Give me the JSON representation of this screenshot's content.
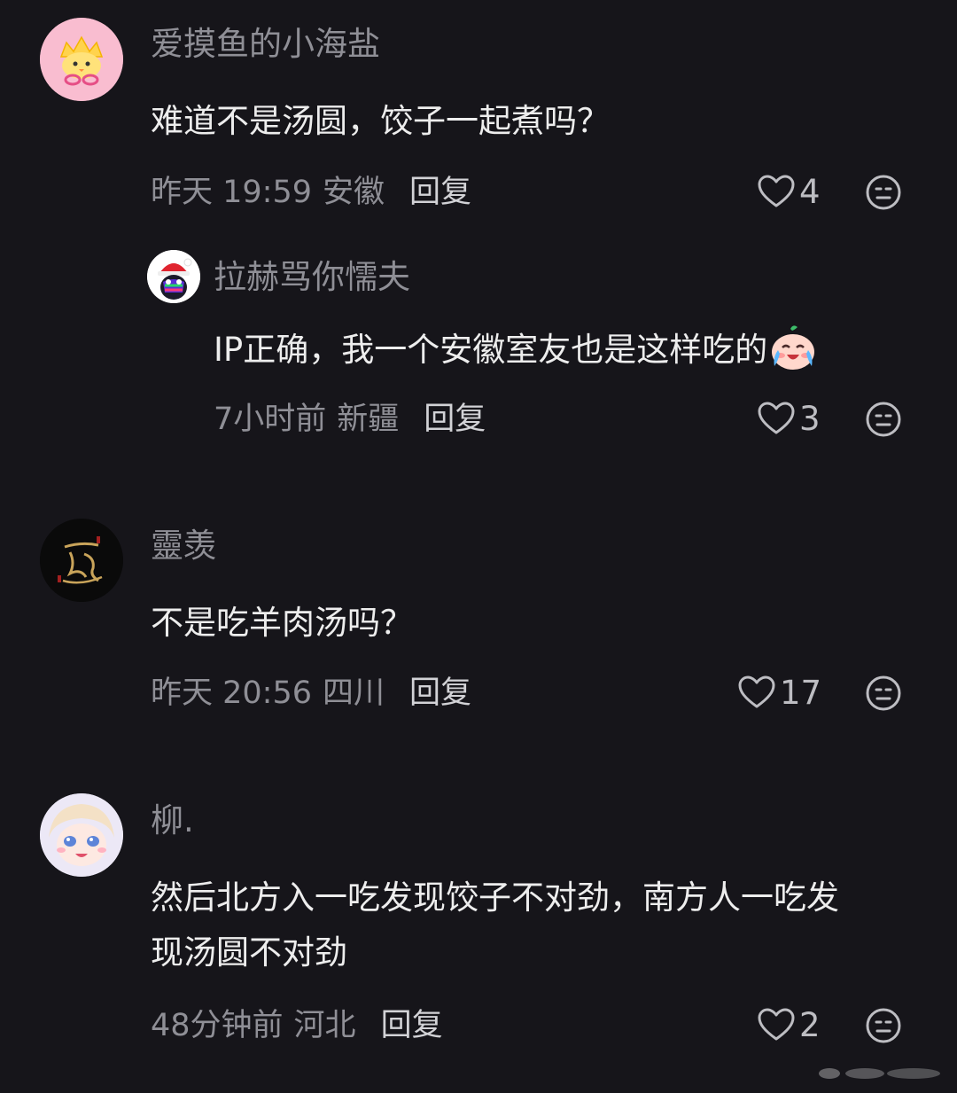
{
  "comments": [
    {
      "username": "爱摸鱼的小海盐",
      "content": "难道不是汤圆，饺子一起煮吗？",
      "time": "昨天 19:59",
      "location": "安徽",
      "reply_label": "回复",
      "likes": "4",
      "avatar_icon": "crown-chick-avatar-icon"
    },
    {
      "username": "拉赫骂你懦夫",
      "content": "IP正确，我一个安徽室友也是这样吃的",
      "time": "7小时前",
      "location": "新疆",
      "reply_label": "回复",
      "likes": "3",
      "avatar_icon": "santa-penguin-avatar-icon",
      "is_reply": true
    },
    {
      "username": "靈羡",
      "content": "不是吃羊肉汤吗？",
      "time": "昨天 20:56",
      "location": "四川",
      "reply_label": "回复",
      "likes": "17",
      "avatar_icon": "calligraphy-avatar-icon"
    },
    {
      "username": "柳.",
      "content_line1": "然后北方入一吃发现饺子不对劲，南方人一吃发",
      "content_line2": "现汤圆不对劲",
      "time": "48分钟前",
      "location": "河北",
      "reply_label": "回复",
      "likes": "2",
      "avatar_icon": "anime-girl-avatar-icon"
    }
  ],
  "colors": {
    "background": "#16151a",
    "username": "#8f8f96",
    "content": "#ededed"
  }
}
